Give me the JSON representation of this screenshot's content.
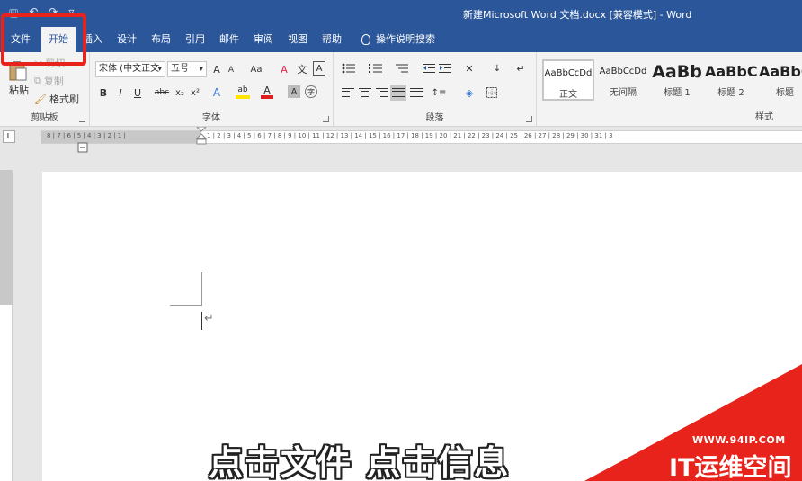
{
  "titlebar": {
    "title": "新建Microsoft Word 文档.docx [兼容模式] - Word",
    "qat_save": "🖫",
    "qat_undo": "↶",
    "qat_redo": "↷",
    "qat_more": "▿"
  },
  "tabs": [
    {
      "label": "文件"
    },
    {
      "label": "开始"
    },
    {
      "label": "插入"
    },
    {
      "label": "设计"
    },
    {
      "label": "布局"
    },
    {
      "label": "引用"
    },
    {
      "label": "邮件"
    },
    {
      "label": "审阅"
    },
    {
      "label": "视图"
    },
    {
      "label": "帮助"
    }
  ],
  "tell_me": "操作说明搜索",
  "clipboard": {
    "paste": "粘贴",
    "cut": "剪切",
    "copy": "复制",
    "format_painter": "格式刷",
    "label": "剪贴板"
  },
  "font": {
    "name": "宋体 (中文正文",
    "size": "五号",
    "grow": "A",
    "shrink": "A",
    "case": "Aa",
    "clear": "A",
    "phonetic": "文",
    "border": "A",
    "bold": "B",
    "italic": "I",
    "underline": "U",
    "strike": "abc",
    "subscript": "x₂",
    "superscript": "x²",
    "effects": "A",
    "highlight": "ab",
    "color": "A",
    "shading": "A",
    "enclose": "字",
    "label": "字体"
  },
  "paragraph": {
    "label": "段落"
  },
  "styles": {
    "label": "样式",
    "items": [
      {
        "sample": "AaBbCcDd",
        "name": "正文"
      },
      {
        "sample": "AaBbCcDd",
        "name": "无间隔"
      },
      {
        "sample": "AaBb",
        "name": "标题 1"
      },
      {
        "sample": "AaBbC",
        "name": "标题 2"
      },
      {
        "sample": "AaBbC",
        "name": "标题"
      }
    ]
  },
  "ruler": {
    "left_numbers": "8 | 7 | 6 | 5 | 4 | 3 | 2 | 1 |",
    "right_numbers": "1 | 2 | 3 | 4 | 5 | 6 | 7 | 8 | 9 | 10 | 11 | 12 | 13 | 14 | 15 | 16 | 17 | 18 | 19 | 20 | 21 | 22 | 23 | 24 | 25 | 26 | 27 | 28 | 29 | 30 | 31 | 3",
    "tab_selector": "L"
  },
  "document": {
    "paragraph_mark": "↵"
  },
  "subtitle": "点击文件  点击信息",
  "watermark": {
    "url": "WWW.94IP.COM",
    "brand": "IT运维空间"
  },
  "colors": {
    "accent": "#2b579a",
    "highlight_box": "#e8231c",
    "watermark": "#e8231c"
  }
}
